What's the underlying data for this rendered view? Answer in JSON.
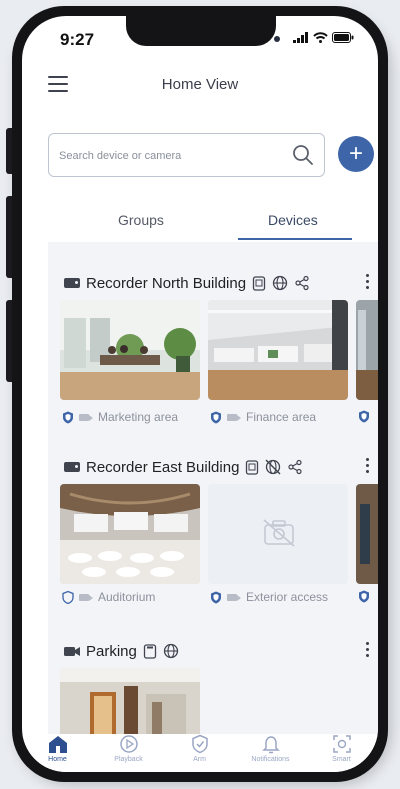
{
  "status": {
    "time": "9:27"
  },
  "header": {
    "title": "Home View"
  },
  "search": {
    "placeholder": "Search device or camera"
  },
  "tabs": [
    {
      "label": "Groups"
    },
    {
      "label": "Devices"
    }
  ],
  "sections": [
    {
      "title": "Recorder North Building",
      "cameras": [
        "Marketing area",
        "Finance area"
      ]
    },
    {
      "title": "Recorder East Building",
      "cameras": [
        "Auditorium",
        "Exterior access"
      ]
    },
    {
      "title": "Parking",
      "cameras": []
    }
  ],
  "bottom_nav": [
    {
      "label": "Home",
      "icon": "home-icon",
      "active": true
    },
    {
      "label": "Playback",
      "icon": "playback-icon"
    },
    {
      "label": "Arm",
      "icon": "shield-icon"
    },
    {
      "label": "Notifications",
      "icon": "bell-icon"
    },
    {
      "label": "Smart",
      "icon": "scan-icon"
    }
  ],
  "colors": {
    "accent": "#3d65a8",
    "tab_active": "#3a4a66",
    "card_bg": "#f2f4f8"
  }
}
